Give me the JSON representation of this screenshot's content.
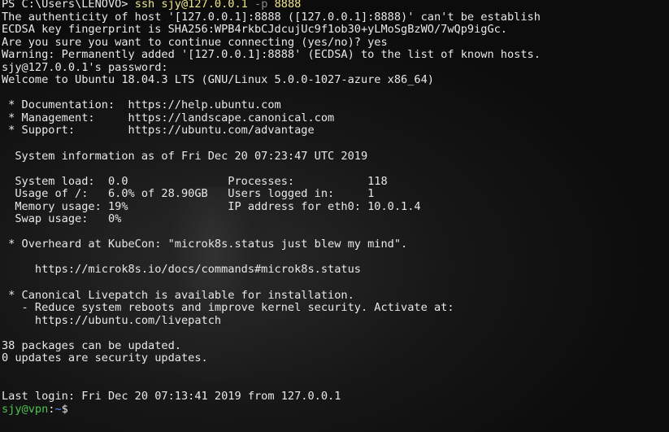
{
  "window": {
    "type": "terminal"
  },
  "session": {
    "ps_prompt": "PS C:\\Users\\LENOVO> ",
    "ssh_command": "ssh sjy@127.0.0.1 ",
    "ssh_flag": "-p",
    "ssh_port": " 8888",
    "lines": [
      "The authenticity of host '[127.0.0.1]:8888 ([127.0.0.1]:8888)' can't be establish",
      "ECDSA key fingerprint is SHA256:WPB4rkbCJdcujUc9f1ob30+yLMoSgBzWO/7wQp9igGc.",
      "Are you sure you want to continue connecting (yes/no)? yes",
      "Warning: Permanently added '[127.0.0.1]:8888' (ECDSA) to the list of known hosts.",
      "sjy@127.0.0.1's password:",
      "Welcome to Ubuntu 18.04.3 LTS (GNU/Linux 5.0.0-1027-azure x86_64)",
      "",
      " * Documentation:  https://help.ubuntu.com",
      " * Management:     https://landscape.canonical.com",
      " * Support:        https://ubuntu.com/advantage",
      "",
      "  System information as of Fri Dec 20 07:23:47 UTC 2019",
      "",
      "  System load:  0.0               Processes:           118",
      "  Usage of /:   6.0% of 28.90GB   Users logged in:     1",
      "  Memory usage: 19%               IP address for eth0: 10.0.1.4",
      "  Swap usage:   0%",
      "",
      " * Overheard at KubeCon: \"microk8s.status just blew my mind\".",
      "",
      "     https://microk8s.io/docs/commands#microk8s.status",
      "",
      " * Canonical Livepatch is available for installation.",
      "   - Reduce system reboots and improve kernel security. Activate at:",
      "     https://ubuntu.com/livepatch",
      "",
      "38 packages can be updated.",
      "0 updates are security updates.",
      "",
      "",
      "Last login: Fri Dec 20 07:13:41 2019 from 127.0.0.1"
    ],
    "bash_prompt": {
      "user_host": "sjy@vpn",
      "separator": ":",
      "path": "~",
      "symbol": "$"
    }
  },
  "colors": {
    "background": "#0c0c0c",
    "text": "#e8e8e8",
    "command": "#f0e68c",
    "flag": "#8a8a8a",
    "prompt_user": "#4ec24e",
    "prompt_path": "#5f8fff"
  }
}
